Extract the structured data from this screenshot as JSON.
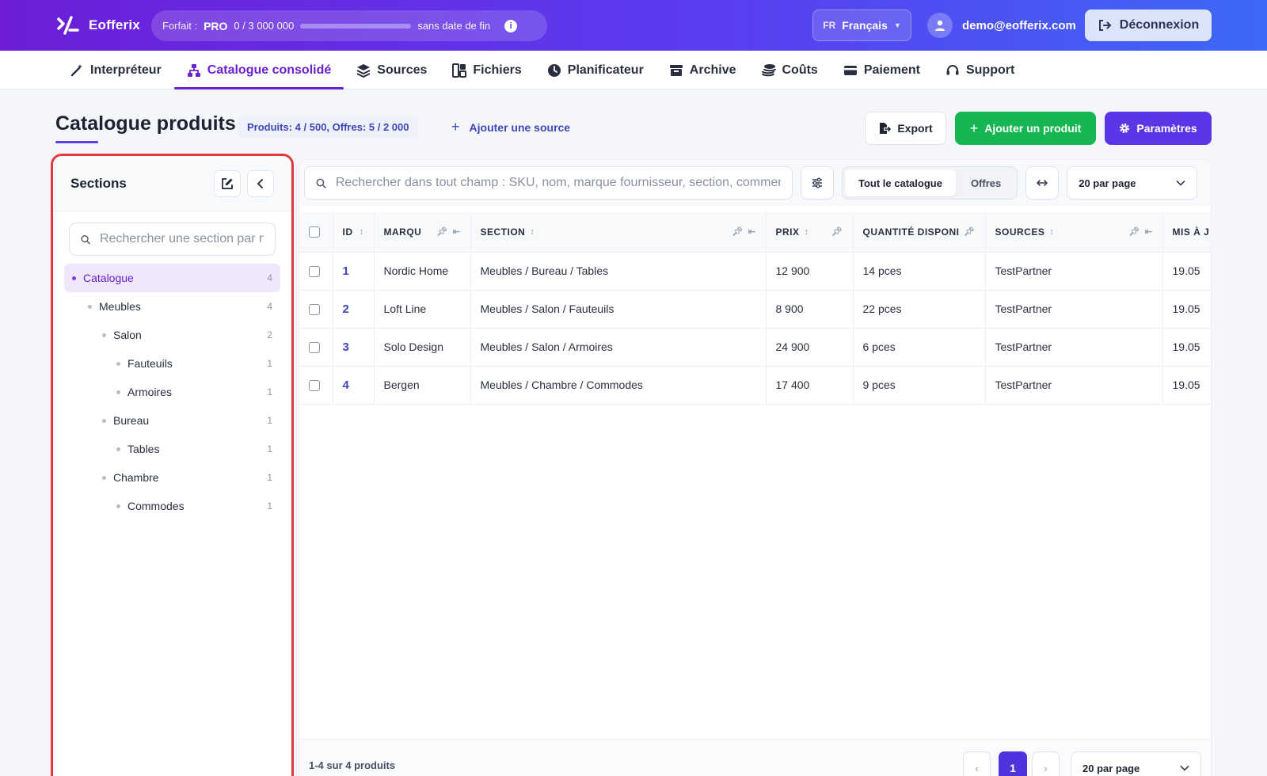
{
  "app": {
    "name": "Eofferix"
  },
  "plan": {
    "label": "Forfait :",
    "tier": "PRO",
    "usage": "0 / 3 000 000",
    "progress": 0,
    "end": "sans date de fin"
  },
  "lang": {
    "code": "FR",
    "name": "Français"
  },
  "user": {
    "email": "demo@eofferix.com"
  },
  "logout_label": "Déconnexion",
  "nav": [
    {
      "label": "Interpréteur",
      "icon": "magic-wand-icon"
    },
    {
      "label": "Catalogue consolidé",
      "icon": "sitemap-icon",
      "active": true
    },
    {
      "label": "Sources",
      "icon": "layers-icon"
    },
    {
      "label": "Fichiers",
      "icon": "files-icon"
    },
    {
      "label": "Planificateur",
      "icon": "clock-icon"
    },
    {
      "label": "Archive",
      "icon": "archive-icon"
    },
    {
      "label": "Coûts",
      "icon": "coins-icon"
    },
    {
      "label": "Paiement",
      "icon": "credit-card-icon"
    },
    {
      "label": "Support",
      "icon": "headset-icon"
    }
  ],
  "page": {
    "title": "Catalogue produits",
    "counts": "Produits: 4 / 500, Offres: 5 / 2 000",
    "add_source": "Ajouter une source",
    "export": "Export",
    "add_product": "Ajouter un produit",
    "settings": "Paramètres"
  },
  "sidebar": {
    "title": "Sections",
    "search_placeholder": "Rechercher une section par nom",
    "tree": [
      {
        "name": "Catalogue",
        "count": "4",
        "level": 0,
        "active": true
      },
      {
        "name": "Meubles",
        "count": "4",
        "level": 1
      },
      {
        "name": "Salon",
        "count": "2",
        "level": 2
      },
      {
        "name": "Fauteuils",
        "count": "1",
        "level": 3
      },
      {
        "name": "Armoires",
        "count": "1",
        "level": 3
      },
      {
        "name": "Bureau",
        "count": "1",
        "level": 2
      },
      {
        "name": "Tables",
        "count": "1",
        "level": 3
      },
      {
        "name": "Chambre",
        "count": "1",
        "level": 2
      },
      {
        "name": "Commodes",
        "count": "1",
        "level": 3
      }
    ]
  },
  "toolbar": {
    "search_placeholder": "Rechercher dans tout champ : SKU, nom, marque fournisseur, section, commentaire",
    "seg_all": "Tout le catalogue",
    "seg_offers": "Offres",
    "per_page": "20 par page"
  },
  "table": {
    "columns": [
      "ID",
      "MARQU",
      "SECTION",
      "PRIX",
      "QUANTITÉ DISPONIBLE",
      "SOURCES",
      "MIS À JOUR"
    ],
    "rows": [
      {
        "id": "1",
        "brand": "Nordic Home",
        "section": "Meubles / Bureau / Tables",
        "price": "12 900",
        "qty": "14 pces",
        "source": "TestPartner",
        "updated": "19.05"
      },
      {
        "id": "2",
        "brand": "Loft Line",
        "section": "Meubles / Salon / Fauteuils",
        "price": "8 900",
        "qty": "22 pces",
        "source": "TestPartner",
        "updated": "19.05"
      },
      {
        "id": "3",
        "brand": "Solo Design",
        "section": "Meubles / Salon / Armoires",
        "price": "24 900",
        "qty": "6 pces",
        "source": "TestPartner",
        "updated": "19.05"
      },
      {
        "id": "4",
        "brand": "Bergen",
        "section": "Meubles / Chambre / Commodes",
        "price": "17 400",
        "qty": "9 pces",
        "source": "TestPartner",
        "updated": "19.05"
      }
    ]
  },
  "footer": {
    "range": "1-4 sur 4 produits",
    "page": "1",
    "per_page": "20 par page",
    "prev": "‹",
    "next": "›"
  },
  "colors": {
    "accent": "#6a21d0",
    "primary": "#5a36e6",
    "success": "#16b653",
    "highlight": "#e0383c"
  }
}
